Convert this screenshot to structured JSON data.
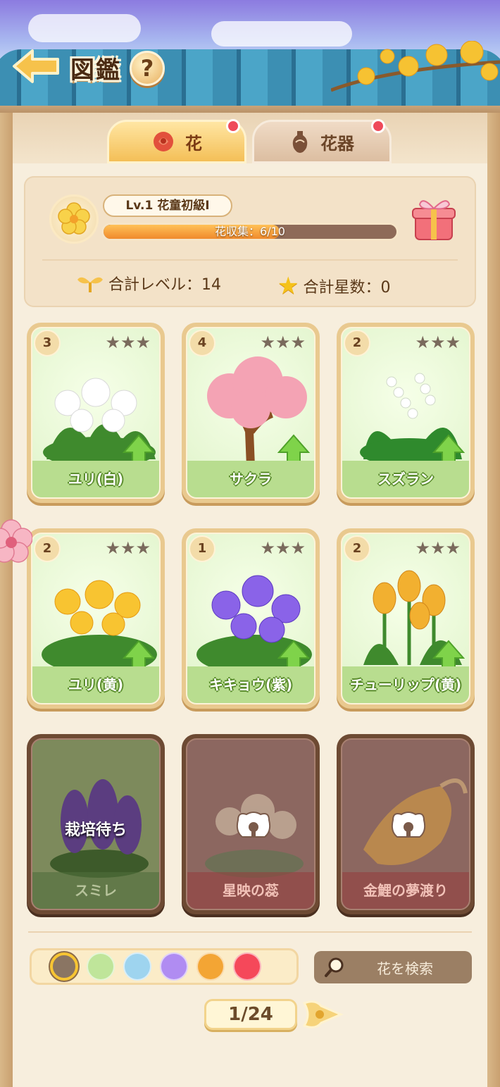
{
  "header": {
    "title": "図鑑",
    "help_label": "?"
  },
  "tabs": [
    {
      "label": "花",
      "icon": "rose-icon",
      "active": true,
      "has_notification": true
    },
    {
      "label": "花器",
      "icon": "vase-icon",
      "active": false,
      "has_notification": true
    }
  ],
  "stats": {
    "level_label": "Lv.1  花童初級Ⅰ",
    "progress_text": "花収集：6/10",
    "progress_fraction": 0.6,
    "total_level": "合計レベル：14",
    "total_stars": "合計星数：0"
  },
  "cards": [
    {
      "name": "ユリ(白)",
      "level": "3",
      "stars": "★★★",
      "status": "owned"
    },
    {
      "name": "サクラ",
      "level": "4",
      "stars": "★★★",
      "status": "owned"
    },
    {
      "name": "スズラン",
      "level": "2",
      "stars": "★★★",
      "status": "owned"
    },
    {
      "name": "ユリ(黄)",
      "level": "2",
      "stars": "★★★",
      "status": "owned"
    },
    {
      "name": "キキョウ(紫)",
      "level": "1",
      "stars": "★★★",
      "status": "owned"
    },
    {
      "name": "チューリップ(黄)",
      "level": "2",
      "stars": "★★★",
      "status": "owned"
    },
    {
      "name": "スミレ",
      "status": "pending",
      "pending_label": "栽培待ち"
    },
    {
      "name": "星映の蕊",
      "status": "locked"
    },
    {
      "name": "金鯉の夢渡り",
      "status": "locked"
    }
  ],
  "color_filter": {
    "colors": [
      "#8a7563",
      "#bfe59a",
      "#9ed4ef",
      "#b08cf2",
      "#f3a534",
      "#f5485a"
    ],
    "selected_index": 0
  },
  "search": {
    "label": "花を検索"
  },
  "pagination": {
    "text": "1/24"
  }
}
